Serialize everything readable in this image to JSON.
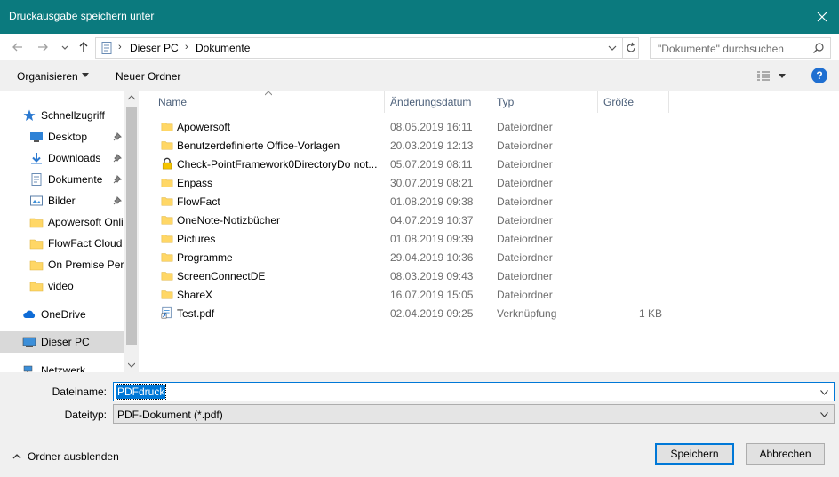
{
  "window": {
    "title": "Druckausgabe speichern unter"
  },
  "address": {
    "crumbs": [
      "Dieser PC",
      "Dokumente"
    ]
  },
  "search": {
    "placeholder": "\"Dokumente\" durchsuchen"
  },
  "toolbar": {
    "organize_label": "Organisieren",
    "new_folder_label": "Neuer Ordner",
    "help_label": "?"
  },
  "sidebar": {
    "items": [
      {
        "label": "Schnellzugriff",
        "icon": "star-icon",
        "pinned": false,
        "top": true
      },
      {
        "label": "Desktop",
        "icon": "desktop-icon",
        "pinned": true,
        "top": false
      },
      {
        "label": "Downloads",
        "icon": "download-icon",
        "pinned": true,
        "top": false
      },
      {
        "label": "Dokumente",
        "icon": "documents-icon",
        "pinned": true,
        "top": false
      },
      {
        "label": "Bilder",
        "icon": "pictures-icon",
        "pinned": true,
        "top": false
      },
      {
        "label": "Apowersoft Onli",
        "icon": "folder-icon",
        "pinned": false,
        "top": false
      },
      {
        "label": "FlowFact Cloud",
        "icon": "folder-icon",
        "pinned": false,
        "top": false
      },
      {
        "label": "On Premise Perf",
        "icon": "folder-icon",
        "pinned": false,
        "top": false
      },
      {
        "label": "video",
        "icon": "folder-icon",
        "pinned": false,
        "top": false
      },
      {
        "label": "OneDrive",
        "icon": "cloud-icon",
        "pinned": false,
        "top": true
      },
      {
        "label": "Dieser PC",
        "icon": "computer-icon",
        "pinned": false,
        "top": true,
        "selected": true
      },
      {
        "label": "Netzwerk",
        "icon": "network-icon",
        "pinned": false,
        "top": true
      }
    ]
  },
  "files": {
    "columns": {
      "name": "Name",
      "date": "Änderungsdatum",
      "type": "Typ",
      "size": "Größe"
    },
    "rows": [
      {
        "name": "Apowersoft",
        "date": "08.05.2019 16:11",
        "type": "Dateiordner",
        "size": "",
        "icon": "folder-icon"
      },
      {
        "name": "Benutzerdefinierte Office-Vorlagen",
        "date": "20.03.2019 12:13",
        "type": "Dateiordner",
        "size": "",
        "icon": "folder-icon"
      },
      {
        "name": "Check-PointFramework0DirectoryDo not...",
        "date": "05.07.2019 08:11",
        "type": "Dateiordner",
        "size": "",
        "icon": "locked-folder-icon"
      },
      {
        "name": "Enpass",
        "date": "30.07.2019 08:21",
        "type": "Dateiordner",
        "size": "",
        "icon": "folder-icon"
      },
      {
        "name": "FlowFact",
        "date": "01.08.2019 09:38",
        "type": "Dateiordner",
        "size": "",
        "icon": "folder-icon"
      },
      {
        "name": "OneNote-Notizbücher",
        "date": "04.07.2019 10:37",
        "type": "Dateiordner",
        "size": "",
        "icon": "folder-icon"
      },
      {
        "name": "Pictures",
        "date": "01.08.2019 09:39",
        "type": "Dateiordner",
        "size": "",
        "icon": "folder-icon"
      },
      {
        "name": "Programme",
        "date": "29.04.2019 10:36",
        "type": "Dateiordner",
        "size": "",
        "icon": "folder-icon"
      },
      {
        "name": "ScreenConnectDE",
        "date": "08.03.2019 09:43",
        "type": "Dateiordner",
        "size": "",
        "icon": "folder-icon"
      },
      {
        "name": "ShareX",
        "date": "16.07.2019 15:05",
        "type": "Dateiordner",
        "size": "",
        "icon": "folder-icon"
      },
      {
        "name": "Test.pdf",
        "date": "02.04.2019 09:25",
        "type": "Verknüpfung",
        "size": "1 KB",
        "icon": "shortcut-icon"
      }
    ]
  },
  "form": {
    "filename_label": "Dateiname:",
    "filename_value": "PDFdruck",
    "filetype_label": "Dateityp:",
    "filetype_value": "PDF-Dokument (*.pdf)"
  },
  "footer": {
    "hide_folders_label": "Ordner ausblenden",
    "save_label": "Speichern",
    "cancel_label": "Abbrechen"
  },
  "colors": {
    "titlebar": "#0b7a7e",
    "accent": "#0078d7",
    "folder": "#ffd766"
  }
}
